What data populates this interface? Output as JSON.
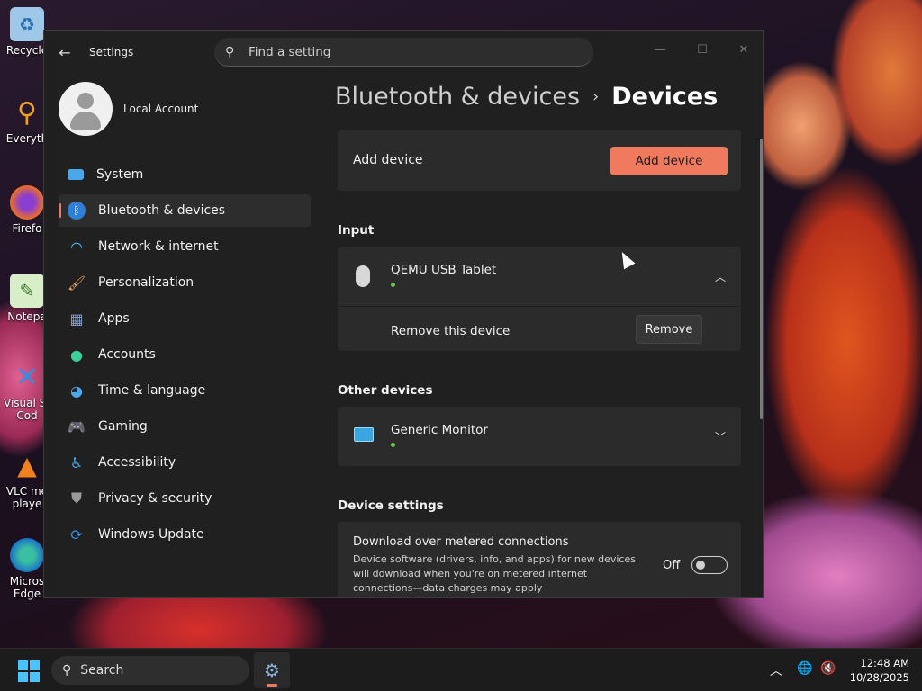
{
  "desktop": {
    "icons": [
      {
        "label": "Recycle",
        "icon": "recycle-bin-icon"
      },
      {
        "label": "Everyth",
        "icon": "everything-search-icon"
      },
      {
        "label": "Firefo",
        "icon": "firefox-icon"
      },
      {
        "label": "Notepa",
        "icon": "notepad-icon"
      },
      {
        "label": "Visual St\nCod",
        "icon": "vscode-icon"
      },
      {
        "label": "VLC me\nplaye",
        "icon": "vlc-icon"
      },
      {
        "label": "Micros\nEdge",
        "icon": "edge-icon"
      }
    ]
  },
  "window": {
    "title": "Settings",
    "search_placeholder": "Find a setting",
    "controls": {
      "minimize": "—",
      "maximize": "☐",
      "close": "✕"
    }
  },
  "profile": {
    "name": "Local Account"
  },
  "nav": {
    "items": [
      {
        "label": "System",
        "icon": "system-icon",
        "color": "#4aa8e8"
      },
      {
        "label": "Bluetooth & devices",
        "icon": "bluetooth-icon",
        "color": "#2f7fd8",
        "active": true
      },
      {
        "label": "Network & internet",
        "icon": "wifi-icon",
        "color": "#4cc2ff"
      },
      {
        "label": "Personalization",
        "icon": "brush-icon",
        "color": "#e8a060"
      },
      {
        "label": "Apps",
        "icon": "apps-icon",
        "color": "#8aa0c8"
      },
      {
        "label": "Accounts",
        "icon": "person-icon",
        "color": "#3ccf9a"
      },
      {
        "label": "Time & language",
        "icon": "globe-clock-icon",
        "color": "#4aa8e8"
      },
      {
        "label": "Gaming",
        "icon": "controller-icon",
        "color": "#b0b0b0"
      },
      {
        "label": "Accessibility",
        "icon": "accessibility-icon",
        "color": "#4aa8e8"
      },
      {
        "label": "Privacy & security",
        "icon": "shield-icon",
        "color": "#9a9a9a"
      },
      {
        "label": "Windows Update",
        "icon": "update-icon",
        "color": "#2f8fe8"
      }
    ]
  },
  "breadcrumb": {
    "parent": "Bluetooth & devices",
    "separator": "›",
    "current": "Devices"
  },
  "add_device": {
    "label": "Add device",
    "button": "Add device"
  },
  "input": {
    "title": "Input",
    "device_name": "QEMU USB Tablet",
    "remove_label": "Remove this device",
    "remove_button": "Remove"
  },
  "other_devices": {
    "title": "Other devices",
    "device_name": "Generic Monitor"
  },
  "device_settings": {
    "title": "Device settings",
    "metered": {
      "title": "Download over metered connections",
      "description": "Device software (drivers, info, and apps) for new devices will download when you're on metered internet connections—data charges may apply",
      "state_label": "Off"
    }
  },
  "taskbar": {
    "search_label": "Search",
    "time": "12:48 AM",
    "date": "10/28/2025"
  },
  "colors": {
    "accent": "#f07a5e",
    "status_dot": "#6cc04a"
  }
}
